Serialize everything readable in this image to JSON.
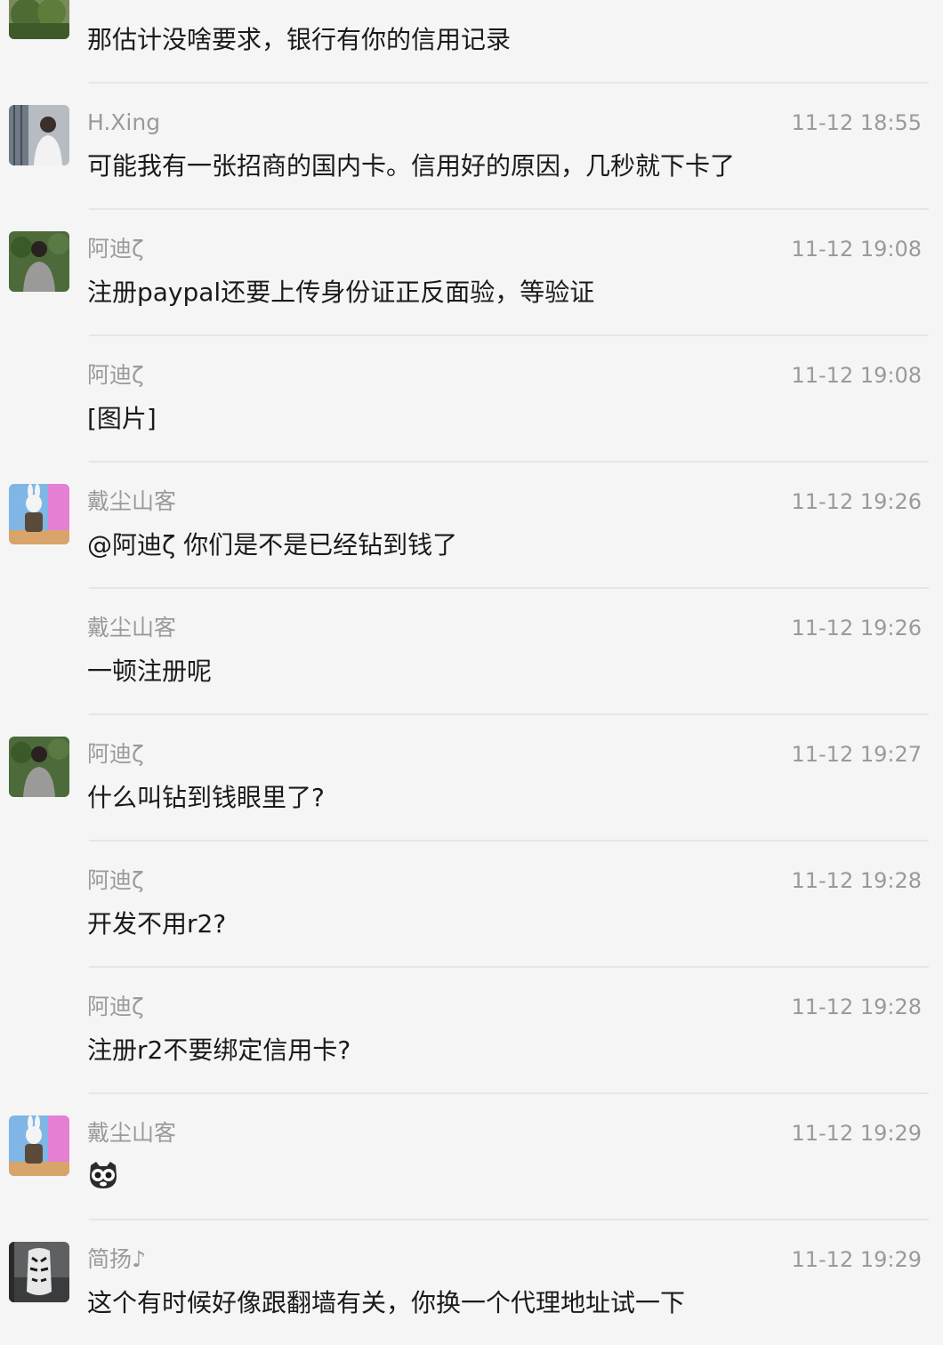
{
  "messages": [
    {
      "sender": "",
      "time": "",
      "text": "那估计没啥要求，银行有你的信用记录",
      "avatar": "landscape-avatar"
    },
    {
      "sender": "H.Xing",
      "time": "11-12 18:55",
      "text": "可能我有一张招商的国内卡。信用好的原因，几秒就下卡了",
      "avatar": "person-white-shirt-avatar"
    },
    {
      "sender": "阿迪ζ",
      "time": "11-12 19:08",
      "text": "注册paypal还要上传身份证正反面验，等验证",
      "avatar": "person-gray-shirt-avatar"
    },
    {
      "sender": "阿迪ζ",
      "time": "11-12 19:08",
      "text": "[图片]",
      "avatar": ""
    },
    {
      "sender": "戴尘山客",
      "time": "11-12 19:26",
      "text": "@阿迪ζ 你们是不是已经钻到钱了",
      "avatar": "rabbit-warrior-avatar"
    },
    {
      "sender": "戴尘山客",
      "time": "11-12 19:26",
      "text": "一顿注册呢",
      "avatar": ""
    },
    {
      "sender": "阿迪ζ",
      "time": "11-12 19:27",
      "text": "什么叫钻到钱眼里了?",
      "avatar": "person-gray-shirt-avatar"
    },
    {
      "sender": "阿迪ζ",
      "time": "11-12 19:28",
      "text": "开发不用r2?",
      "avatar": ""
    },
    {
      "sender": "阿迪ζ",
      "time": "11-12 19:28",
      "text": "注册r2不要绑定信用卡?",
      "avatar": ""
    },
    {
      "sender": "戴尘山客",
      "time": "11-12 19:29",
      "text": "",
      "emoji": "owl-face-emoji",
      "avatar": "rabbit-warrior-avatar"
    },
    {
      "sender": "简扬♪",
      "time": "11-12 19:29",
      "text": "这个有时候好像跟翻墙有关，你换一个代理地址试一下",
      "avatar": "tiger-avatar"
    }
  ],
  "colors": {
    "background": "#f5f5f5",
    "divider": "#e6e6e6",
    "meta_text": "#9a9a9a",
    "body_text": "#1a1a1a"
  }
}
